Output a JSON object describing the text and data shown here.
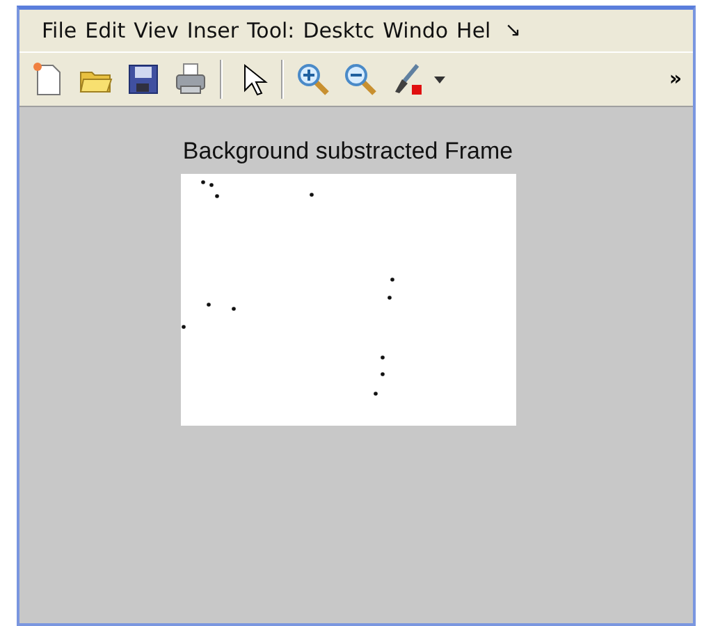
{
  "menu": [
    "File",
    "Edit",
    "Viev",
    "Inser",
    "Tool:",
    "Desktc",
    "Windo",
    "Hel"
  ],
  "menu_overflow": "↘",
  "toolbar": {
    "overflow": "»"
  },
  "figure": {
    "title": "Background substracted Frame"
  }
}
